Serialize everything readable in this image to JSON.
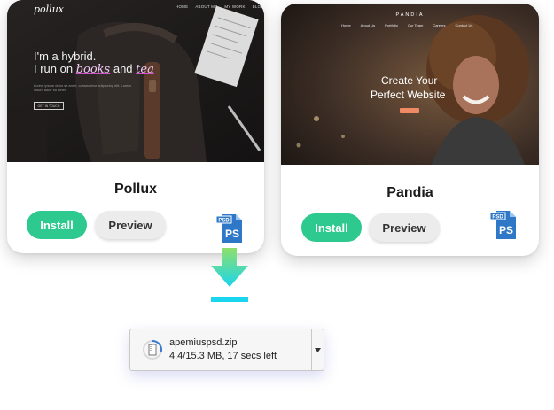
{
  "cards": [
    {
      "title": "Pollux",
      "install_label": "Install",
      "preview_label": "Preview",
      "file_badge": "PSD",
      "file_type": "PS",
      "thumbnail": {
        "logo": "pollux",
        "nav": [
          "HOME",
          "ABOUT ME",
          "MY WORK",
          "BLOG"
        ],
        "headline_1": "I'm a hybrid.",
        "headline_2_prefix": "I run on ",
        "headline_2_word_1": "books",
        "headline_2_mid": " and ",
        "headline_2_word_2": "tea",
        "body": "Lorem ipsum dolor sit amet, consectetur adipiscing elit. Lorem ipsum dolor sit amet.",
        "cta": "GET IN TOUCH"
      }
    },
    {
      "title": "Pandia",
      "install_label": "Install",
      "preview_label": "Preview",
      "file_badge": "PSD",
      "file_type": "PS",
      "thumbnail": {
        "brand": "PANDIA",
        "nav": [
          "Home",
          "About Us",
          "Portfolio",
          "Our Team",
          "Careers",
          "Contact Us"
        ],
        "headline_1": "Create Your",
        "headline_2": "Perfect Website",
        "cta": ""
      }
    }
  ],
  "download": {
    "filename": "apemiuspsd.zip",
    "status": "4.4/15.3 MB, 17 secs left",
    "progress": 0.29
  },
  "colors": {
    "install": "#2ec98e",
    "preview_bg": "#ececec",
    "psd_blue": "#2f78c7",
    "arrow_top": "#8fe06a",
    "arrow_bottom": "#19d5ee"
  }
}
